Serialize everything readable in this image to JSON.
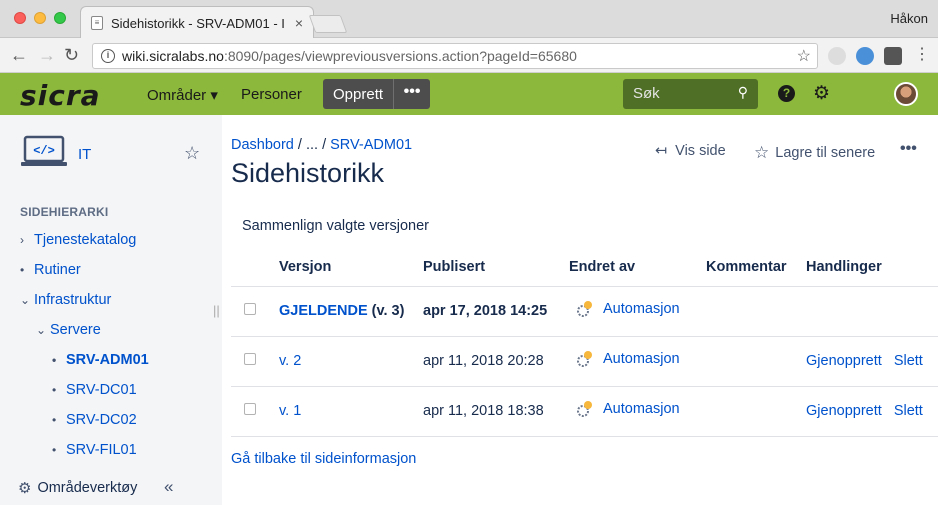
{
  "browser": {
    "tab_title": "Sidehistorikk - SRV-ADM01 - I",
    "tab_close": "×",
    "profile": "Håkon",
    "url_host": "wiki.sicralabs.no",
    "url_rest": ":8090/pages/viewpreviousversions.action?pageId=65680"
  },
  "header": {
    "logo": "sicra",
    "nav_spaces": "Områder ▾",
    "nav_people": "Personer",
    "create": "Opprett",
    "create_more": "•••",
    "search_placeholder": "Søk",
    "help": "?"
  },
  "sidebar": {
    "space_name": "IT",
    "heading": "SIDEHIERARKI",
    "tree": [
      {
        "label": "Tjenestekatalog",
        "marker": "›"
      },
      {
        "label": "Rutiner",
        "marker": "•"
      },
      {
        "label": "Infrastruktur",
        "marker": "⌄"
      },
      {
        "label": "Servere",
        "marker": "⌄"
      },
      {
        "label": "SRV-ADM01",
        "marker": "•"
      },
      {
        "label": "SRV-DC01",
        "marker": "•"
      },
      {
        "label": "SRV-DC02",
        "marker": "•"
      },
      {
        "label": "SRV-FIL01",
        "marker": "•"
      }
    ],
    "tools": "Områdeverktøy",
    "collapse": "«"
  },
  "breadcrumb": {
    "dashboard": "Dashbord",
    "ellipsis": "/ ... /",
    "page": "SRV-ADM01"
  },
  "page_actions": {
    "view": "Vis side",
    "save": "Lagre til senere",
    "more": "•••"
  },
  "page": {
    "title": "Sidehistorikk",
    "compare": "Sammenlign valgte versjoner",
    "back": "Gå tilbake til sideinformasjon"
  },
  "table": {
    "headers": {
      "version": "Versjon",
      "published": "Publisert",
      "changed_by": "Endret av",
      "comment": "Kommentar",
      "actions": "Handlinger"
    },
    "rows": [
      {
        "version": "GJELDENDE",
        "version_suffix": " (v. 3)",
        "published": "apr 17, 2018 14:25",
        "changed_by": "Automasjon",
        "restore": "",
        "delete": ""
      },
      {
        "version": "v. 2",
        "version_suffix": "",
        "published": "apr 11, 2018 20:28",
        "changed_by": "Automasjon",
        "restore": "Gjenopprett",
        "delete": "Slett"
      },
      {
        "version": "v. 1",
        "version_suffix": "",
        "published": "apr 11, 2018 18:38",
        "changed_by": "Automasjon",
        "restore": "Gjenopprett",
        "delete": "Slett"
      }
    ]
  }
}
